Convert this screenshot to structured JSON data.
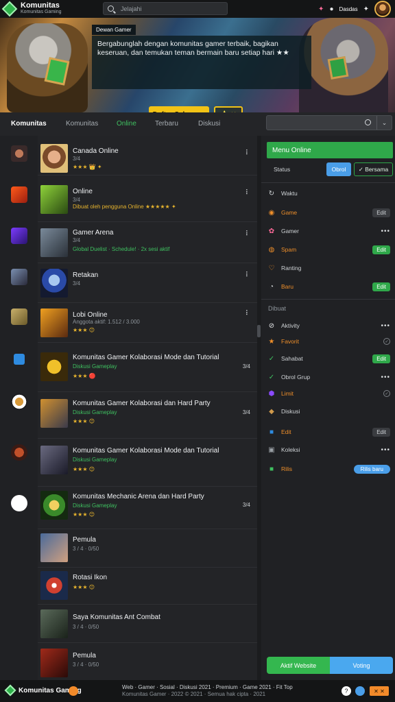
{
  "app": {
    "title": "Komunitas",
    "subtitle": "Komunitas Gaming"
  },
  "search": {
    "placeholder": "Jelajahi"
  },
  "user": {
    "name": "Dasdas"
  },
  "banner": {
    "tag": "Dewan Gamer",
    "text": "Bergabunglah dengan komunitas gamer terbaik, bagikan keseruan, dan temukan teman bermain baru setiap hari ★★",
    "primary_btn": "Daftar Sekarang",
    "secondary_btn": "⭐ ✕"
  },
  "tabs": [
    "Komunitas",
    "Komunitas",
    "Online",
    "Terbaru",
    "Diskusi"
  ],
  "list": [
    {
      "title": "Canada Online",
      "sub": "3/4",
      "meta": "★★★ 👑 ✦"
    },
    {
      "title": "Online",
      "sub": "3/4",
      "meta": "Dibuat oleh pengguna Online ★★★★★ ✦"
    },
    {
      "title": "Gamer Arena",
      "sub": "3/4",
      "meta": "Global Duelist · Schedule! · 2x sesi aktif",
      "green": true
    },
    {
      "title": "Retakan",
      "sub": "3/4",
      "meta": ""
    },
    {
      "title": "Lobi Online",
      "sub": "Anggota aktif: 1.512 / 3.000",
      "meta": "★★★ 😊"
    },
    {
      "title": "Komunitas Gamer Kolaborasi Mode dan Tutorial",
      "sub": "Diskusi Gameplay",
      "meta": "★★★ 🔴",
      "num": "3/4"
    },
    {
      "title": "Komunitas Gamer Kolaborasi dan Hard Party",
      "sub": "Diskusi Gameplay",
      "meta": "★★★ 😊",
      "num": "3/4"
    },
    {
      "title": "Komunitas Gamer Kolaborasi Mode dan Tutorial",
      "sub": "Diskusi Gameplay",
      "meta": "★★★ 😊",
      "num": ""
    },
    {
      "title": "Komunitas Mechanic Arena dan Hard Party",
      "sub": "Diskusi Gameplay",
      "meta": "★★★ 😊",
      "num": "3/4"
    },
    {
      "title": "Pemula",
      "sub": "3 / 4 · 0/50",
      "meta": ""
    },
    {
      "title": "Rotasi Ikon",
      "sub": "",
      "meta": "★★★ 😊"
    },
    {
      "title": "Saya Komunitas Ant Combat",
      "sub": "3 / 4 · 0/50",
      "meta": ""
    },
    {
      "title": "Pemula",
      "sub": "3 / 4 · 0/50",
      "meta": ""
    }
  ],
  "right": {
    "header": "Menu Online",
    "sub": "Status",
    "btn1": "Obrol",
    "btn2": "✓ Bersama",
    "items_top": [
      {
        "label": "Waktu",
        "right": ""
      },
      {
        "label": "Game",
        "right": "Edit",
        "orange": true
      },
      {
        "label": "Gamer",
        "right": "•••"
      },
      {
        "label": "Spam",
        "right": "Edit",
        "orange": true
      },
      {
        "label": "Ranting",
        "right": ""
      },
      {
        "label": "Baru",
        "right": "Edit",
        "orange": true
      }
    ],
    "section": "Dibuat",
    "items_bottom": [
      {
        "label": "Aktivity",
        "right": "•••"
      },
      {
        "label": "Favorit",
        "right": ""
      },
      {
        "label": "Sahabat",
        "right": "Edit"
      },
      {
        "label": "Obrol Grup",
        "right": "•••"
      },
      {
        "label": "Limit",
        "right": ""
      },
      {
        "label": "Diskusi",
        "right": "•••"
      },
      {
        "label": "Edit",
        "right": "Edit"
      },
      {
        "label": "Koleksi",
        "right": "•••"
      },
      {
        "label": "Rilis",
        "right": "Rilis baru"
      }
    ],
    "bottom_left": "Aktif Website",
    "bottom_right": "Voting"
  },
  "footer": {
    "brand": "Komunitas Gaming",
    "info_line1": "Web · Gamer · Sosial · Diskusi 2021 · Premium · Game 2021 · Fit Top",
    "info_line2": "Komunitas Gamer · 2022 © 2021 · Semua hak cipta · 2021",
    "badge": "✕ ✕"
  }
}
